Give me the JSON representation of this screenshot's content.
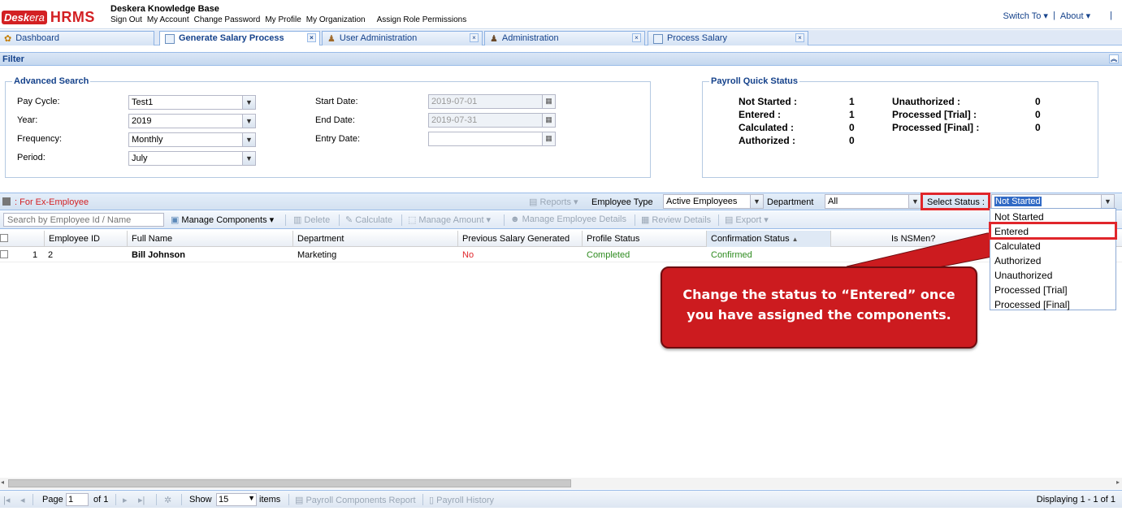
{
  "header": {
    "logo_prefix": "Desk",
    "logo_suffix": "era",
    "logo_product": "HRMS",
    "site_title": "Deskera Knowledge Base",
    "menu": [
      "Sign Out",
      "My Account",
      "Change Password",
      "My Profile",
      "My Organization",
      "Assign Role Permissions"
    ],
    "switch_to": "Switch To",
    "about": "About",
    "separator": "|"
  },
  "tabs": [
    {
      "label": "Dashboard",
      "icon": "dashboard-icon"
    },
    {
      "label": "Generate Salary Process",
      "icon": "document-icon",
      "active": true
    },
    {
      "label": "User Administration",
      "icon": "users-icon"
    },
    {
      "label": "Administration",
      "icon": "person-icon"
    },
    {
      "label": "Process Salary",
      "icon": "document-icon"
    }
  ],
  "filter": {
    "title": "Filter",
    "advanced_search": {
      "legend": "Advanced Search",
      "pay_cycle_label": "Pay Cycle:",
      "pay_cycle_value": "Test1",
      "year_label": "Year:",
      "year_value": "2019",
      "frequency_label": "Frequency:",
      "frequency_value": "Monthly",
      "period_label": "Period:",
      "period_value": "July",
      "start_date_label": "Start Date:",
      "start_date_value": "2019-07-01",
      "end_date_label": "End Date:",
      "end_date_value": "2019-07-31",
      "entry_date_label": "Entry Date:",
      "entry_date_value": ""
    },
    "quick_status": {
      "legend": "Payroll Quick Status",
      "not_started_label": "Not Started :",
      "not_started_value": "1",
      "entered_label": "Entered :",
      "entered_value": "1",
      "calculated_label": "Calculated :",
      "calculated_value": "0",
      "authorized_label": "Authorized :",
      "authorized_value": "0",
      "unauthorized_label": "Unauthorized :",
      "unauthorized_value": "0",
      "processed_trial_label": "Processed [Trial] :",
      "processed_trial_value": "0",
      "processed_final_label": "Processed [Final] :",
      "processed_final_value": "0"
    }
  },
  "gridbar": {
    "ex_employee_legend": ": For Ex-Employee",
    "reports": "Reports",
    "employee_type_label": "Employee Type",
    "employee_type_value": "Active Employees",
    "department_label": "Department",
    "department_value": "All",
    "select_status_label": "Select Status :",
    "select_status_value": "Not Started"
  },
  "toolbar": {
    "search_placeholder": "Search by Employee Id / Name",
    "manage_components": "Manage Components",
    "delete": "Delete",
    "calculate": "Calculate",
    "manage_amount": "Manage Amount",
    "manage_employee_details": "Manage Employee Details",
    "review_details": "Review Details",
    "export": "Export"
  },
  "columns": [
    "Employee ID",
    "Full Name",
    "Department",
    "Previous Salary Generated",
    "Profile Status",
    "Confirmation Status",
    "Is NSMen?"
  ],
  "rows": [
    {
      "num": "1",
      "employee_id": "2",
      "full_name": "Bill Johnson",
      "department": "Marketing",
      "previous_salary": "No",
      "profile_status": "Completed",
      "confirmation_status": "Confirmed"
    }
  ],
  "status_options": [
    "Not Started",
    "Entered",
    "Calculated",
    "Authorized",
    "Unauthorized",
    "Processed [Trial]",
    "Processed [Final]"
  ],
  "callout": {
    "text": "Change the status to “Entered” once you have assigned the components."
  },
  "pager": {
    "page_label": "Page",
    "page_value": "1",
    "of_label": "of 1",
    "show_label": "Show",
    "show_value": "15",
    "items_label": "items",
    "payroll_components_report": "Payroll Components Report",
    "payroll_history": "Payroll History",
    "displaying": "Displaying 1 - 1 of 1"
  },
  "colors": {
    "brand_red": "#d32023",
    "link_blue": "#15428b",
    "highlight_red": "#e0262b",
    "no_red": "#e0262b",
    "ok_green": "#2e8b1f"
  }
}
